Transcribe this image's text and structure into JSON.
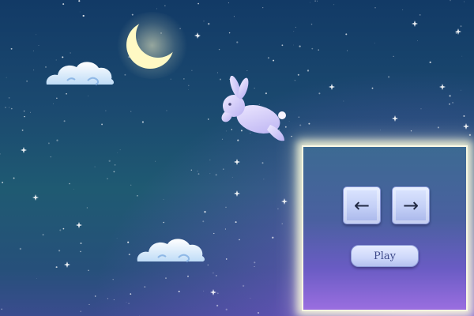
{
  "scene": {
    "colors": {
      "sky_top": "#123a66",
      "sky_glow": "#b478ff",
      "moon": "#fff9c4",
      "cloud": "#dff0ff",
      "rabbit": "#dcd6ff",
      "panel_border": "#fffbe6"
    },
    "icons": {
      "moon": "crescent-moon-icon",
      "clouds": "cloud-icon",
      "player": "rabbit-icon",
      "left": "arrow-left-icon",
      "right": "arrow-right-icon"
    }
  },
  "controls": {
    "left_icon": "←",
    "right_icon": "→",
    "play_label": "Play"
  }
}
